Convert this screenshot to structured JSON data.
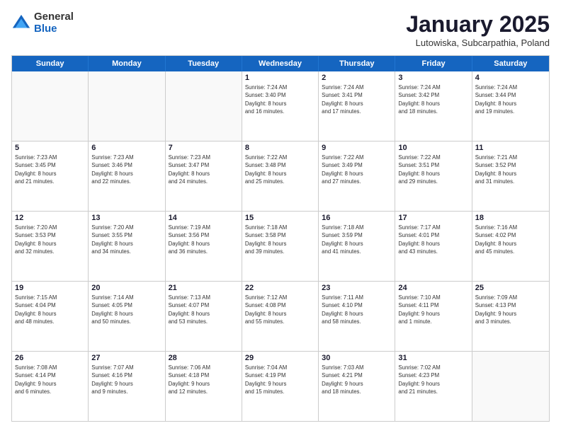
{
  "logo": {
    "general": "General",
    "blue": "Blue"
  },
  "title": "January 2025",
  "location": "Lutowiska, Subcarpathia, Poland",
  "days": [
    "Sunday",
    "Monday",
    "Tuesday",
    "Wednesday",
    "Thursday",
    "Friday",
    "Saturday"
  ],
  "weeks": [
    [
      {
        "day": "",
        "info": ""
      },
      {
        "day": "",
        "info": ""
      },
      {
        "day": "",
        "info": ""
      },
      {
        "day": "1",
        "info": "Sunrise: 7:24 AM\nSunset: 3:40 PM\nDaylight: 8 hours\nand 16 minutes."
      },
      {
        "day": "2",
        "info": "Sunrise: 7:24 AM\nSunset: 3:41 PM\nDaylight: 8 hours\nand 17 minutes."
      },
      {
        "day": "3",
        "info": "Sunrise: 7:24 AM\nSunset: 3:42 PM\nDaylight: 8 hours\nand 18 minutes."
      },
      {
        "day": "4",
        "info": "Sunrise: 7:24 AM\nSunset: 3:44 PM\nDaylight: 8 hours\nand 19 minutes."
      }
    ],
    [
      {
        "day": "5",
        "info": "Sunrise: 7:23 AM\nSunset: 3:45 PM\nDaylight: 8 hours\nand 21 minutes."
      },
      {
        "day": "6",
        "info": "Sunrise: 7:23 AM\nSunset: 3:46 PM\nDaylight: 8 hours\nand 22 minutes."
      },
      {
        "day": "7",
        "info": "Sunrise: 7:23 AM\nSunset: 3:47 PM\nDaylight: 8 hours\nand 24 minutes."
      },
      {
        "day": "8",
        "info": "Sunrise: 7:22 AM\nSunset: 3:48 PM\nDaylight: 8 hours\nand 25 minutes."
      },
      {
        "day": "9",
        "info": "Sunrise: 7:22 AM\nSunset: 3:49 PM\nDaylight: 8 hours\nand 27 minutes."
      },
      {
        "day": "10",
        "info": "Sunrise: 7:22 AM\nSunset: 3:51 PM\nDaylight: 8 hours\nand 29 minutes."
      },
      {
        "day": "11",
        "info": "Sunrise: 7:21 AM\nSunset: 3:52 PM\nDaylight: 8 hours\nand 31 minutes."
      }
    ],
    [
      {
        "day": "12",
        "info": "Sunrise: 7:20 AM\nSunset: 3:53 PM\nDaylight: 8 hours\nand 32 minutes."
      },
      {
        "day": "13",
        "info": "Sunrise: 7:20 AM\nSunset: 3:55 PM\nDaylight: 8 hours\nand 34 minutes."
      },
      {
        "day": "14",
        "info": "Sunrise: 7:19 AM\nSunset: 3:56 PM\nDaylight: 8 hours\nand 36 minutes."
      },
      {
        "day": "15",
        "info": "Sunrise: 7:18 AM\nSunset: 3:58 PM\nDaylight: 8 hours\nand 39 minutes."
      },
      {
        "day": "16",
        "info": "Sunrise: 7:18 AM\nSunset: 3:59 PM\nDaylight: 8 hours\nand 41 minutes."
      },
      {
        "day": "17",
        "info": "Sunrise: 7:17 AM\nSunset: 4:01 PM\nDaylight: 8 hours\nand 43 minutes."
      },
      {
        "day": "18",
        "info": "Sunrise: 7:16 AM\nSunset: 4:02 PM\nDaylight: 8 hours\nand 45 minutes."
      }
    ],
    [
      {
        "day": "19",
        "info": "Sunrise: 7:15 AM\nSunset: 4:04 PM\nDaylight: 8 hours\nand 48 minutes."
      },
      {
        "day": "20",
        "info": "Sunrise: 7:14 AM\nSunset: 4:05 PM\nDaylight: 8 hours\nand 50 minutes."
      },
      {
        "day": "21",
        "info": "Sunrise: 7:13 AM\nSunset: 4:07 PM\nDaylight: 8 hours\nand 53 minutes."
      },
      {
        "day": "22",
        "info": "Sunrise: 7:12 AM\nSunset: 4:08 PM\nDaylight: 8 hours\nand 55 minutes."
      },
      {
        "day": "23",
        "info": "Sunrise: 7:11 AM\nSunset: 4:10 PM\nDaylight: 8 hours\nand 58 minutes."
      },
      {
        "day": "24",
        "info": "Sunrise: 7:10 AM\nSunset: 4:11 PM\nDaylight: 9 hours\nand 1 minute."
      },
      {
        "day": "25",
        "info": "Sunrise: 7:09 AM\nSunset: 4:13 PM\nDaylight: 9 hours\nand 3 minutes."
      }
    ],
    [
      {
        "day": "26",
        "info": "Sunrise: 7:08 AM\nSunset: 4:14 PM\nDaylight: 9 hours\nand 6 minutes."
      },
      {
        "day": "27",
        "info": "Sunrise: 7:07 AM\nSunset: 4:16 PM\nDaylight: 9 hours\nand 9 minutes."
      },
      {
        "day": "28",
        "info": "Sunrise: 7:06 AM\nSunset: 4:18 PM\nDaylight: 9 hours\nand 12 minutes."
      },
      {
        "day": "29",
        "info": "Sunrise: 7:04 AM\nSunset: 4:19 PM\nDaylight: 9 hours\nand 15 minutes."
      },
      {
        "day": "30",
        "info": "Sunrise: 7:03 AM\nSunset: 4:21 PM\nDaylight: 9 hours\nand 18 minutes."
      },
      {
        "day": "31",
        "info": "Sunrise: 7:02 AM\nSunset: 4:23 PM\nDaylight: 9 hours\nand 21 minutes."
      },
      {
        "day": "",
        "info": ""
      }
    ]
  ]
}
